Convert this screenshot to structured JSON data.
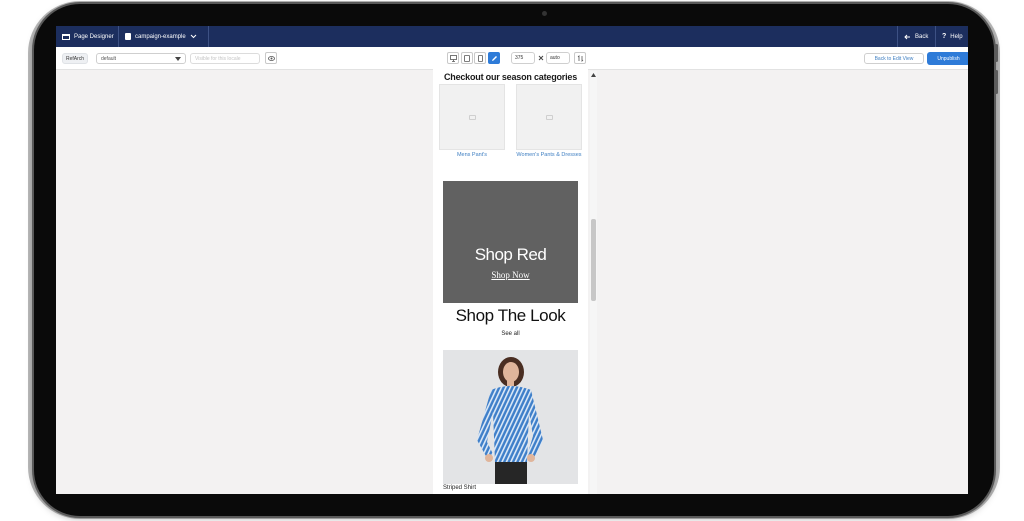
{
  "topbar": {
    "app_title": "Page Designer",
    "page_name": "campaign-example",
    "back_label": "Back",
    "help_label": "Help"
  },
  "toolbar": {
    "site_badge": "RefArch",
    "locale_value": "default",
    "publish_placeholder": "Visible for this locale",
    "width_value": "375",
    "height_value": "auto",
    "back_to_edit_label": "Back to Edit View",
    "unpublish_label": "Unpublish"
  },
  "page": {
    "categories_title": "Checkout our season categories",
    "categories": [
      {
        "label": "Mens Pant's"
      },
      {
        "label": "Women's Pants & Dresses"
      }
    ],
    "banner": {
      "title": "Shop Red",
      "link": "Shop Now"
    },
    "look": {
      "title": "Shop The Look",
      "see_all": "See all"
    },
    "product": {
      "name": "Striped Shirt"
    }
  },
  "colors": {
    "topbar": "#1c2e5e",
    "accent": "#2e7bd8",
    "banner": "#616161",
    "link": "#3f7fc2"
  },
  "icons": [
    "app-icon",
    "document-icon",
    "chevron-down-icon",
    "arrow-left-icon",
    "help-icon",
    "eye-icon",
    "desktop-icon",
    "tablet-icon",
    "phone-icon",
    "pencil-icon",
    "swap-icon",
    "close-icon",
    "image-placeholder-icon"
  ]
}
